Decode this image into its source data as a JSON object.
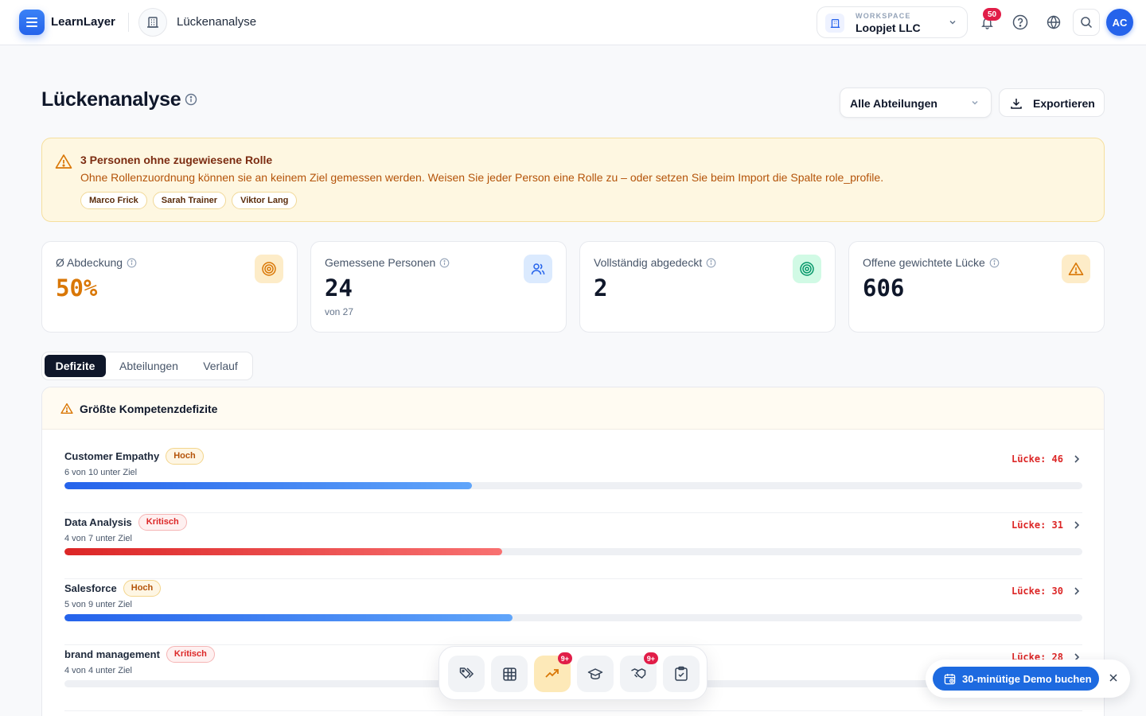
{
  "app": {
    "brand": "LearnLayer",
    "breadcrumb": "Lückenanalyse"
  },
  "workspace": {
    "kicker": "WORKSPACE",
    "name": "Loopjet LLC"
  },
  "header": {
    "notifications_count": "50",
    "avatar_initials": "AC"
  },
  "page": {
    "title": "Lückenanalyse",
    "department_filter": "Alle Abteilungen",
    "export_label": "Exportieren"
  },
  "alert": {
    "title": "3 Personen ohne zugewiesene Rolle",
    "description": "Ohne Rollenzuordnung können sie an keinem Ziel gemessen werden. Weisen Sie jeder Person eine Rolle zu – oder setzen Sie beim Import die Spalte role_profile.",
    "people": [
      "Marco Frick",
      "Sarah Trainer",
      "Viktor Lang"
    ]
  },
  "stats": [
    {
      "label": "Ø Abdeckung",
      "value": "50%",
      "sub": "",
      "icon": "target-icon",
      "color": "#d97706"
    },
    {
      "label": "Gemessene Personen",
      "value": "24",
      "sub": "von 27",
      "icon": "users-icon",
      "color": "#2563eb"
    },
    {
      "label": "Vollständig abgedeckt",
      "value": "2",
      "sub": "",
      "icon": "target-icon",
      "color": "#059669"
    },
    {
      "label": "Offene gewichtete Lücke",
      "value": "606",
      "sub": "",
      "icon": "warning-icon",
      "color": "#d97706"
    }
  ],
  "tabs": [
    "Defizite",
    "Abteilungen",
    "Verlauf"
  ],
  "deficits": {
    "title": "Größte Kompetenzdefizite",
    "rows": [
      {
        "name": "Customer Empathy",
        "severity": "Hoch",
        "count": "6 von 10 unter Ziel",
        "gap": "Lücke: 46",
        "progress": 0.4
      },
      {
        "name": "Data Analysis",
        "severity": "Kritisch",
        "count": "4 von 7 unter Ziel",
        "gap": "Lücke: 31",
        "progress": 0.43
      },
      {
        "name": "Salesforce",
        "severity": "Hoch",
        "count": "5 von 9 unter Ziel",
        "gap": "Lücke: 30",
        "progress": 0.44
      },
      {
        "name": "brand management",
        "severity": "Kritisch",
        "count": "4 von 4 unter Ziel",
        "gap": "Lücke: 28",
        "progress": 0.0
      }
    ]
  },
  "dock": {
    "badge_1": "9+",
    "badge_2": "9+"
  },
  "demo": {
    "label": "30-minütige Demo buchen"
  }
}
